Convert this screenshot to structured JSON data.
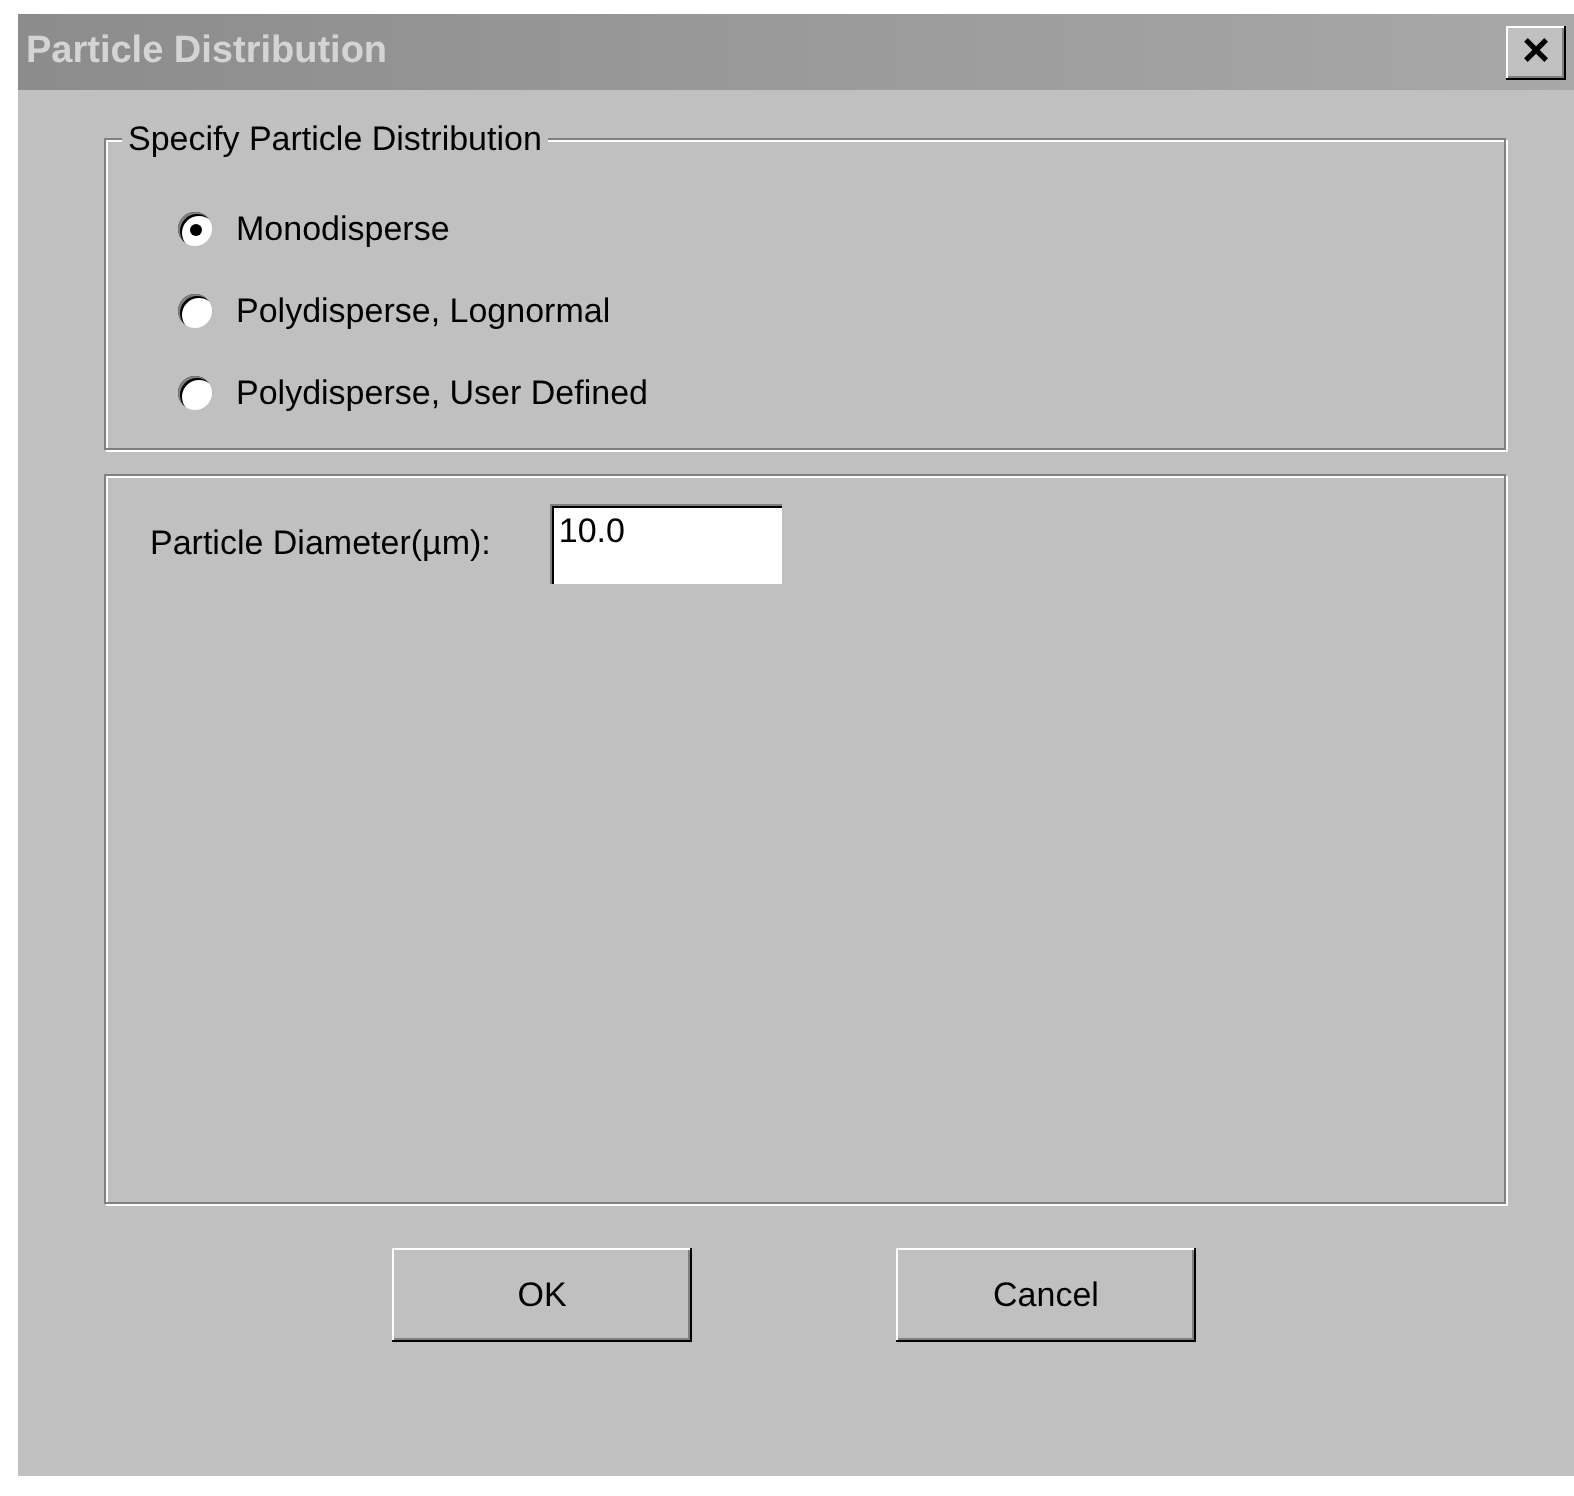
{
  "window": {
    "title": "Particle Distribution",
    "active": false,
    "close_label": "×"
  },
  "distribution_group": {
    "legend": "Specify Particle Distribution",
    "options": [
      {
        "label": "Monodisperse",
        "selected": true
      },
      {
        "label": "Polydisperse, Lognormal",
        "selected": false
      },
      {
        "label": "Polydisperse, User Defined",
        "selected": false
      }
    ]
  },
  "parameters": {
    "fields": [
      {
        "label": "Particle Diameter(µm):",
        "value": "10.0"
      }
    ]
  },
  "buttons": [
    "OK",
    "Cancel"
  ]
}
